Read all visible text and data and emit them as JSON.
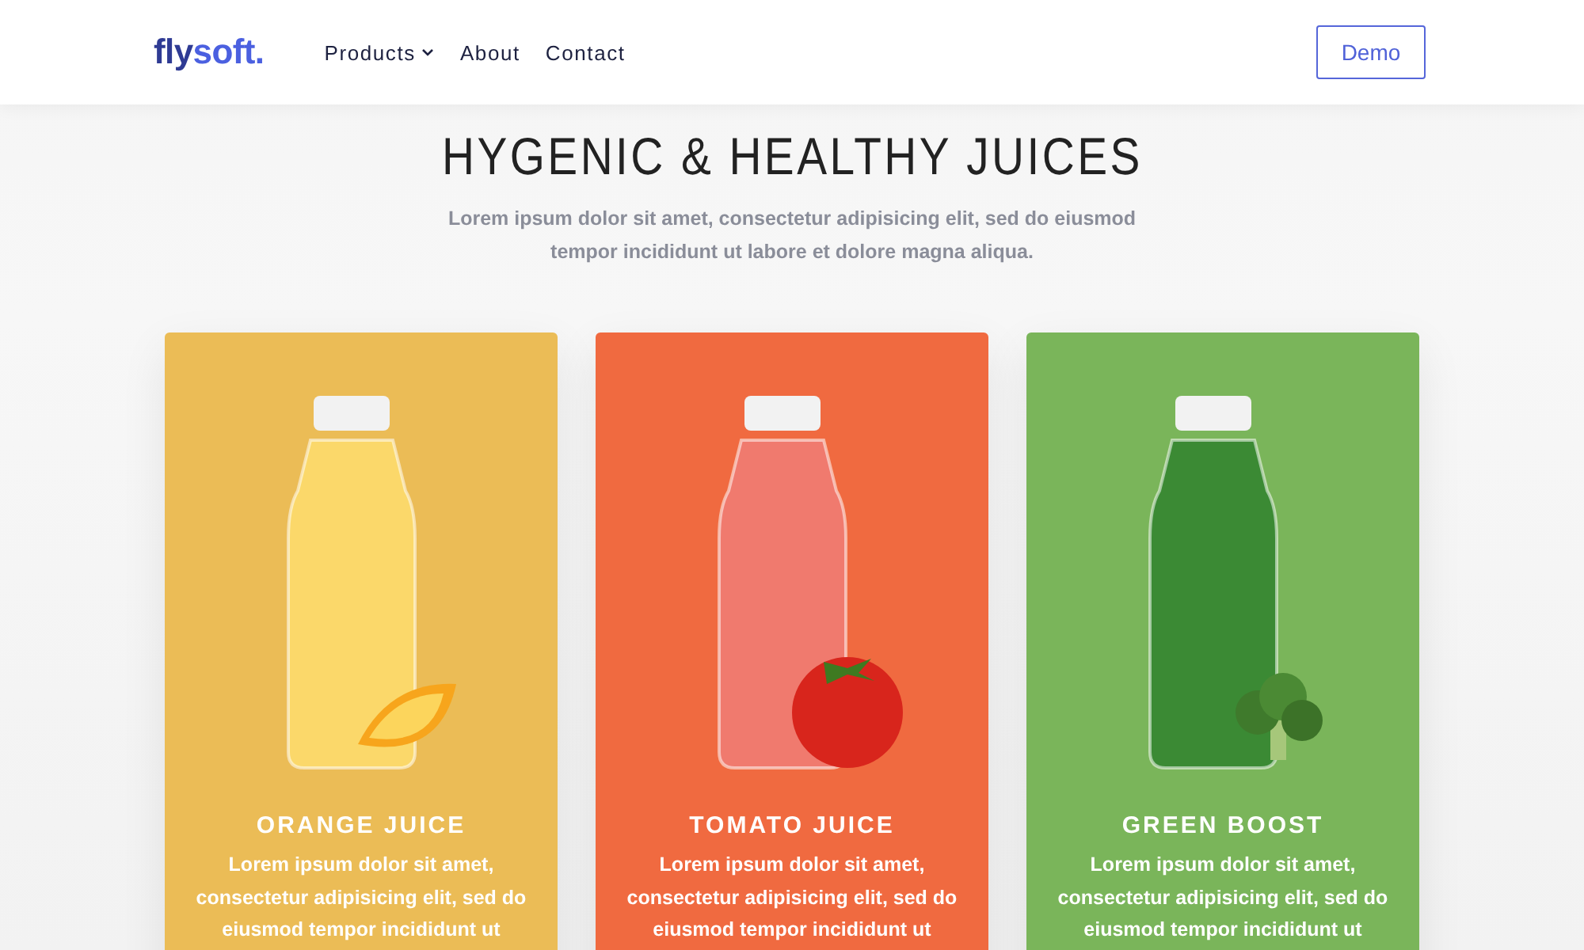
{
  "header": {
    "logo": {
      "lead": "fly",
      "rest": "soft."
    },
    "nav": [
      {
        "label": "Products",
        "has_dropdown": true
      },
      {
        "label": "About",
        "has_dropdown": false
      },
      {
        "label": "Contact",
        "has_dropdown": false
      }
    ],
    "cta": "Demo"
  },
  "hero": {
    "title": "HYGENIC & HEALTHY JUICES",
    "subtitle": "Lorem ipsum dolor sit amet, consectetur adipisicing elit, sed do eiusmod tempor incididunt ut labore et dolore magna aliqua."
  },
  "cards": [
    {
      "kind": "orange",
      "title": "ORANGE JUICE",
      "text": "Lorem ipsum dolor sit amet, consectetur adipisicing elit, sed do eiusmod tempor incididunt ut",
      "color": "#ebbc56"
    },
    {
      "kind": "tomato",
      "title": "TOMATO JUICE",
      "text": "Lorem ipsum dolor sit amet, consectetur adipisicing elit, sed do eiusmod tempor incididunt ut",
      "color": "#f06a40"
    },
    {
      "kind": "broccoli",
      "title": "GREEN BOOST",
      "text": "Lorem ipsum dolor sit amet, consectetur adipisicing elit, sed do eiusmod tempor incididunt ut",
      "color": "#7ab55a"
    }
  ]
}
